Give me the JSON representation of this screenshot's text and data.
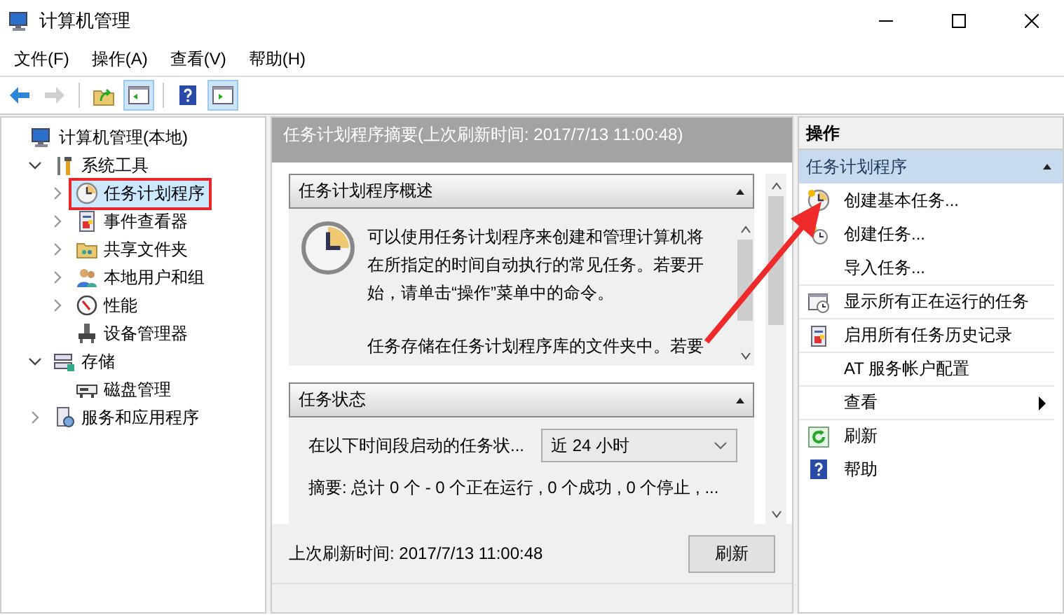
{
  "window": {
    "title": "计算机管理"
  },
  "menu": [
    "文件(F)",
    "操作(A)",
    "查看(V)",
    "帮助(H)"
  ],
  "toolbar": [
    [
      {
        "kind": "back",
        "disabled": false,
        "pressed": false
      },
      {
        "kind": "forward",
        "disabled": true,
        "pressed": false
      }
    ],
    [
      {
        "kind": "up",
        "disabled": false,
        "pressed": false
      },
      {
        "kind": "tree",
        "disabled": false,
        "pressed": true
      }
    ],
    [
      {
        "kind": "help",
        "disabled": false,
        "pressed": false
      },
      {
        "kind": "actions",
        "disabled": false,
        "pressed": true
      }
    ]
  ],
  "tree": [
    {
      "label": "计算机管理(本地)",
      "selected": false,
      "outlined": false,
      "children": [
        {
          "label": "系统工具",
          "expanded": true,
          "selected": false,
          "outlined": false,
          "children": [
            {
              "label": "任务计划程序",
              "expanded": false,
              "selected": true,
              "outlined": true
            },
            {
              "label": "事件查看器",
              "expanded": false,
              "selected": false,
              "outlined": false
            },
            {
              "label": "共享文件夹",
              "expanded": false,
              "selected": false,
              "outlined": false
            },
            {
              "label": "本地用户和组",
              "expanded": false,
              "selected": false,
              "outlined": false
            },
            {
              "label": "性能",
              "expanded": false,
              "selected": false,
              "outlined": false
            },
            {
              "label": "设备管理器",
              "selected": false,
              "outlined": false
            }
          ]
        },
        {
          "label": "存储",
          "expanded": true,
          "selected": false,
          "outlined": false,
          "children": [
            {
              "label": "磁盘管理",
              "selected": false,
              "outlined": false
            }
          ]
        },
        {
          "label": "服务和应用程序",
          "expanded": false,
          "selected": false,
          "outlined": false
        }
      ]
    }
  ],
  "center": {
    "header": "任务计划程序摘要(上次刷新时间: 2017/7/13 11:00:48)",
    "sections": [
      {
        "title": "任务计划程序概述",
        "expanded": true,
        "kind": "overview",
        "paragraphs": [
          "可以使用任务计划程序来创建和管理计算机将在所指定的时间自动执行的常见任务。若要开始，请单击“操作”菜单中的命令。",
          "任务存储在任务计划程序库的文件夹中。若要"
        ]
      },
      {
        "title": "任务状态",
        "expanded": true,
        "kind": "status",
        "filter_label": "在以下时间段启动的任务状...",
        "filter_value": "近 24 小时",
        "summary": "摘要: 总计 0 个 - 0 个正在运行 , 0 个成功 , 0 个停止 , ..."
      }
    ],
    "footer_text": "上次刷新时间: 2017/7/13 11:00:48",
    "refresh_button": "刷新"
  },
  "actions": {
    "title": "操作",
    "group": {
      "title": "任务计划程序",
      "expanded": true
    },
    "items": [
      {
        "label": "创建基本任务...",
        "submenu": false,
        "divider": false
      },
      {
        "label": "创建任务...",
        "submenu": false,
        "divider": false
      },
      {
        "label": "导入任务...",
        "submenu": false,
        "divider": false
      },
      {
        "label": "显示所有正在运行的任务",
        "submenu": false,
        "divider": true
      },
      {
        "label": "启用所有任务历史记录",
        "submenu": false,
        "divider": true
      },
      {
        "label": "AT 服务帐户配置",
        "submenu": false,
        "divider": true
      },
      {
        "label": "查看",
        "submenu": true,
        "divider": true
      },
      {
        "label": "刷新",
        "submenu": false,
        "divider": true
      },
      {
        "label": "帮助",
        "submenu": false,
        "divider": false
      }
    ]
  },
  "annotation": {
    "arrow": true
  }
}
